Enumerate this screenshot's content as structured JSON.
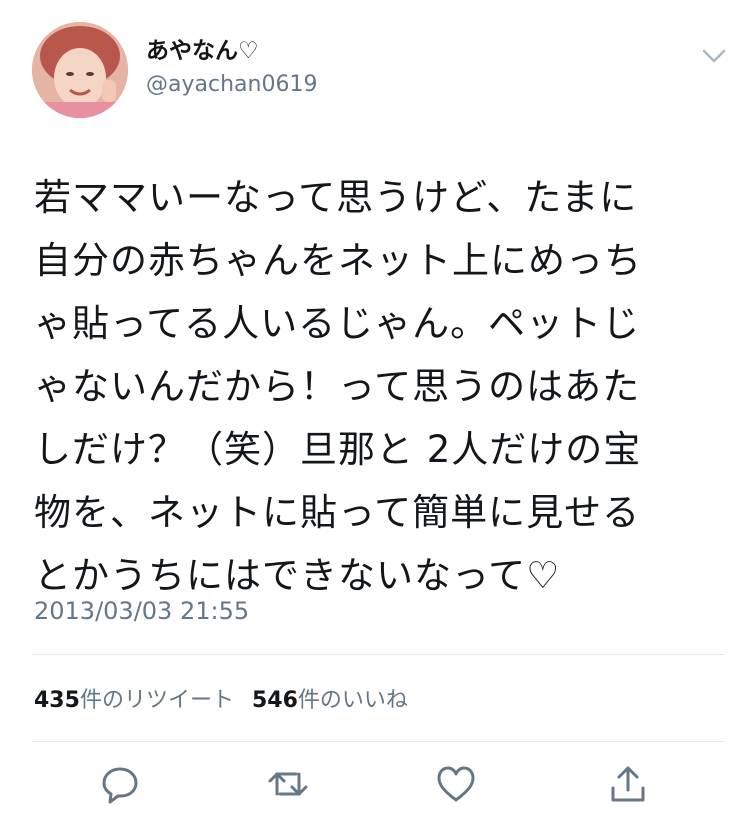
{
  "user": {
    "display_name": "あやなん♡",
    "handle": "@ayachan0619"
  },
  "tweet": {
    "text": "若ママいーなって思うけど、たまに\n自分の赤ちゃんをネット上にめっち\nゃ貼ってる人いるじゃん。ペットじ\nゃないんだから！って思うのはあた\nしだけ？（笑）旦那と 2人だけの宝\n物を、ネットに貼って簡単に見せる\nとかうちにはできないなって♡",
    "timestamp": "2013/03/03 21:55"
  },
  "stats": {
    "retweets_count": "435",
    "retweets_label": "件のリツイート",
    "likes_count": "546",
    "likes_label": "件のいいね"
  },
  "icons": {
    "caret": "chevron-down-icon",
    "reply": "reply-icon",
    "retweet": "retweet-icon",
    "like": "heart-icon",
    "share": "share-icon"
  },
  "colors": {
    "text": "#14171a",
    "secondary": "#657786",
    "divider": "#e1e8ed"
  }
}
